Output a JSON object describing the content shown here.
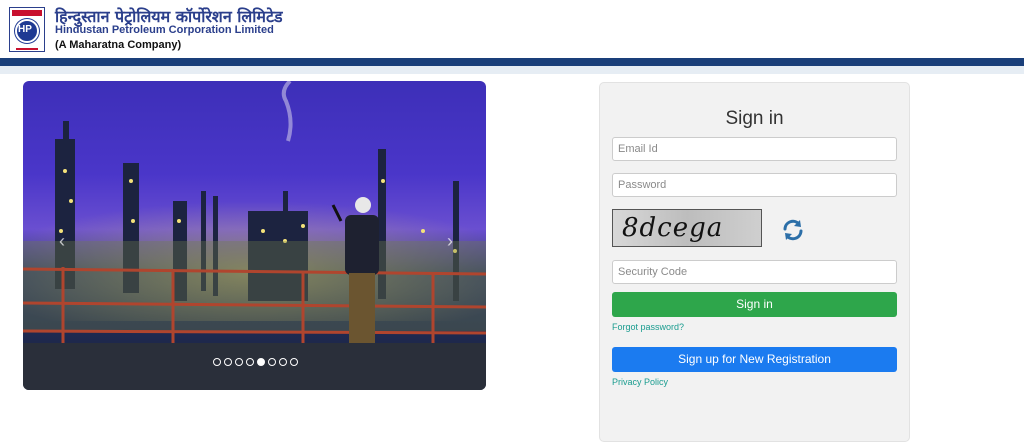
{
  "header": {
    "logo_text": "HP",
    "brand_hindi": "हिन्दुस्तान पेट्रोलियम कॉर्पोरेशन लिमिटेड",
    "brand_english": "Hindustan Petroleum Corporation Limited",
    "brand_subtitle": "(A Maharatna Company)"
  },
  "carousel": {
    "slide_count": 8,
    "active_index": 4
  },
  "login": {
    "title": "Sign in",
    "email_placeholder": "Email Id",
    "password_placeholder": "Password",
    "captcha_text": "8dcega",
    "security_placeholder": "Security Code",
    "signin_button": "Sign in",
    "forgot_password": "Forgot password?",
    "signup_button": "Sign up for New Registration",
    "privacy_policy": "Privacy Policy"
  },
  "colors": {
    "brand_blue": "#2b3f8c",
    "navbar": "#1a3f7a",
    "signin_green": "#2ea64b",
    "signup_blue": "#1b7bf0",
    "link_teal": "#1a9c8f"
  },
  "icons": {
    "refresh": "refresh-icon",
    "prev": "chevron-left-icon",
    "next": "chevron-right-icon"
  }
}
